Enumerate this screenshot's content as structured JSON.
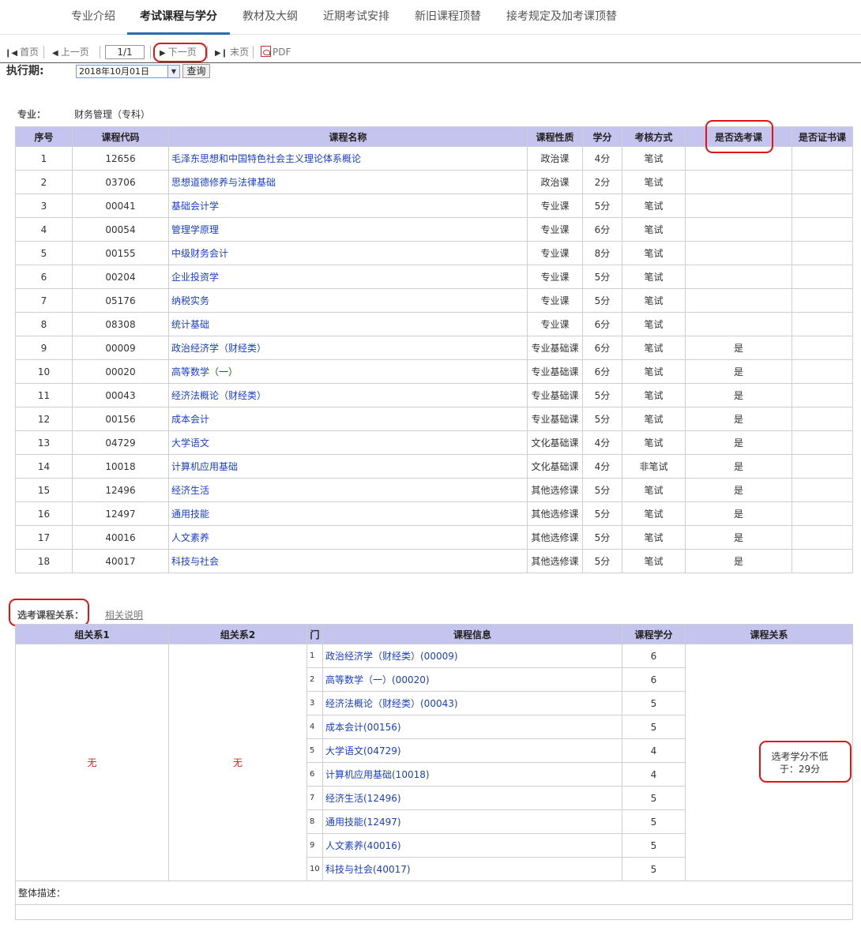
{
  "tabs": [
    {
      "label": "专业介绍",
      "active": false
    },
    {
      "label": "考试课程与学分",
      "active": true
    },
    {
      "label": "教材及大纲",
      "active": false
    },
    {
      "label": "近期考试安排",
      "active": false
    },
    {
      "label": "新旧课程顶替",
      "active": false
    },
    {
      "label": "接考规定及加考课顶替",
      "active": false
    }
  ],
  "toolbar": {
    "first": "首页",
    "prev": "上一页",
    "page": "1/1",
    "next": "下一页",
    "last": "末页",
    "pdf": "PDF"
  },
  "date_filter": {
    "label": "执行期:",
    "value": "2018年10月01日",
    "query": "查询"
  },
  "major": {
    "label": "专业：",
    "value": "财务管理（专科）"
  },
  "course_table": {
    "headers": [
      "序号",
      "课程代码",
      "课程名称",
      "课程性质",
      "学分",
      "考核方式",
      "是否选考课",
      "是否证书课"
    ],
    "rows": [
      [
        "1",
        "12656",
        "毛泽东思想和中国特色社会主义理论体系概论",
        "政治课",
        "4分",
        "笔试",
        "",
        ""
      ],
      [
        "2",
        "03706",
        "思想道德修养与法律基础",
        "政治课",
        "2分",
        "笔试",
        "",
        ""
      ],
      [
        "3",
        "00041",
        "基础会计学",
        "专业课",
        "5分",
        "笔试",
        "",
        ""
      ],
      [
        "4",
        "00054",
        "管理学原理",
        "专业课",
        "6分",
        "笔试",
        "",
        ""
      ],
      [
        "5",
        "00155",
        "中级财务会计",
        "专业课",
        "8分",
        "笔试",
        "",
        ""
      ],
      [
        "6",
        "00204",
        "企业投资学",
        "专业课",
        "5分",
        "笔试",
        "",
        ""
      ],
      [
        "7",
        "05176",
        "纳税实务",
        "专业课",
        "5分",
        "笔试",
        "",
        ""
      ],
      [
        "8",
        "08308",
        "统计基础",
        "专业课",
        "6分",
        "笔试",
        "",
        ""
      ],
      [
        "9",
        "00009",
        "政治经济学（财经类）",
        "专业基础课",
        "6分",
        "笔试",
        "是",
        ""
      ],
      [
        "10",
        "00020",
        "高等数学（一）",
        "专业基础课",
        "6分",
        "笔试",
        "是",
        ""
      ],
      [
        "11",
        "00043",
        "经济法概论（财经类）",
        "专业基础课",
        "5分",
        "笔试",
        "是",
        ""
      ],
      [
        "12",
        "00156",
        "成本会计",
        "专业基础课",
        "5分",
        "笔试",
        "是",
        ""
      ],
      [
        "13",
        "04729",
        "大学语文",
        "文化基础课",
        "4分",
        "笔试",
        "是",
        ""
      ],
      [
        "14",
        "10018",
        "计算机应用基础",
        "文化基础课",
        "4分",
        "非笔试",
        "是",
        ""
      ],
      [
        "15",
        "12496",
        "经济生活",
        "其他选修课",
        "5分",
        "笔试",
        "是",
        ""
      ],
      [
        "16",
        "12497",
        "通用技能",
        "其他选修课",
        "5分",
        "笔试",
        "是",
        ""
      ],
      [
        "17",
        "40016",
        "人文素养",
        "其他选修课",
        "5分",
        "笔试",
        "是",
        ""
      ],
      [
        "18",
        "40017",
        "科技与社会",
        "其他选修课",
        "5分",
        "笔试",
        "是",
        ""
      ]
    ]
  },
  "elective_section": {
    "title": "选考课程关系：",
    "link": "相关说明",
    "headers": [
      "组关系1",
      "组关系2",
      "门",
      "课程信息",
      "课程学分",
      "课程关系"
    ],
    "group1": "无",
    "group2": "无",
    "relation": "选考学分不低于：29分",
    "rows": [
      [
        "1",
        "政治经济学（财经类）(00009)",
        "6"
      ],
      [
        "2",
        "高等数学（一）(00020)",
        "6"
      ],
      [
        "3",
        "经济法概论（财经类）(00043)",
        "5"
      ],
      [
        "4",
        "成本会计(00156)",
        "5"
      ],
      [
        "5",
        "大学语文(04729)",
        "4"
      ],
      [
        "6",
        "计算机应用基础(10018)",
        "4"
      ],
      [
        "7",
        "经济生活(12496)",
        "5"
      ],
      [
        "8",
        "通用技能(12497)",
        "5"
      ],
      [
        "9",
        "人文素养(40016)",
        "5"
      ],
      [
        "10",
        "科技与社会(40017)",
        "5"
      ]
    ],
    "overall_label": "整体描述："
  }
}
